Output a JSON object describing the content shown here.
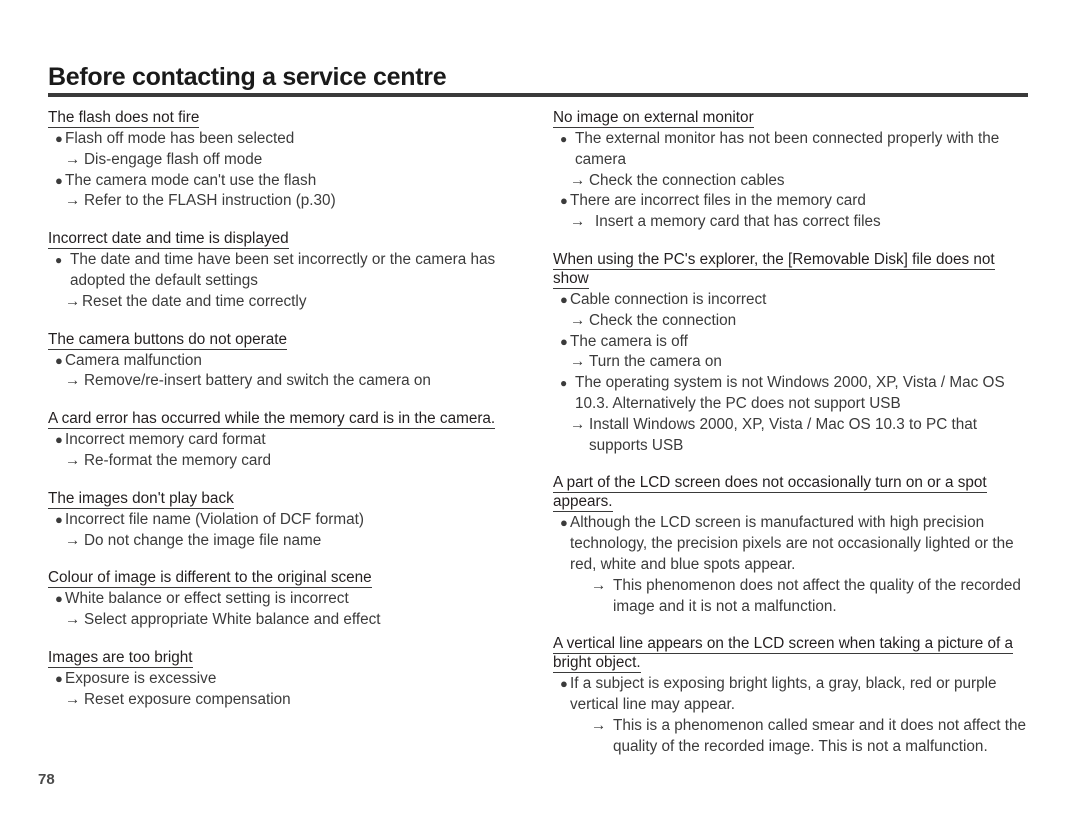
{
  "page": {
    "title": "Before contacting a service centre",
    "folio": "78"
  },
  "left_column": [
    {
      "heading": "The flash does not fire",
      "lines": [
        {
          "type": "bullet",
          "gap": false,
          "text": "Flash off mode has been selected"
        },
        {
          "type": "arrow",
          "indent": "tight",
          "text": "Dis-engage flash off mode"
        },
        {
          "type": "bullet",
          "gap": false,
          "text": "The camera mode can't use the flash"
        },
        {
          "type": "arrow",
          "indent": "tight",
          "text": "Refer to the FLASH instruction (p.30)"
        }
      ]
    },
    {
      "heading": "Incorrect date and time is displayed",
      "lines": [
        {
          "type": "bullet",
          "gap": true,
          "text": "The date and time have been set incorrectly or the camera has adopted the default settings"
        },
        {
          "type": "arrow",
          "indent": "none",
          "text": "Reset the date and time correctly"
        }
      ]
    },
    {
      "heading": "The camera buttons do not operate",
      "lines": [
        {
          "type": "bullet",
          "gap": false,
          "text": "Camera malfunction"
        },
        {
          "type": "arrow",
          "indent": "tight",
          "text": "Remove/re-insert battery and switch the camera on"
        }
      ]
    },
    {
      "heading": "A card error has occurred while the memory card is in the camera.",
      "lines": [
        {
          "type": "bullet",
          "gap": false,
          "text": "Incorrect memory card format"
        },
        {
          "type": "arrow",
          "indent": "tight",
          "text": "Re-format the memory card"
        }
      ]
    },
    {
      "heading": "The images don't play back",
      "lines": [
        {
          "type": "bullet",
          "gap": false,
          "text": "Incorrect file name (Violation of DCF format)"
        },
        {
          "type": "arrow",
          "indent": "tight",
          "text": "Do not change the image file name"
        }
      ]
    },
    {
      "heading": "Colour of image is different to the original scene",
      "lines": [
        {
          "type": "bullet",
          "gap": false,
          "text": "White balance or effect setting is incorrect"
        },
        {
          "type": "arrow",
          "indent": "tight",
          "text": "Select appropriate White balance and effect"
        }
      ]
    },
    {
      "heading": "Images are too bright",
      "lines": [
        {
          "type": "bullet",
          "gap": false,
          "text": "Exposure is excessive"
        },
        {
          "type": "arrow",
          "indent": "tight",
          "text": "Reset exposure compensation"
        }
      ]
    }
  ],
  "right_column": [
    {
      "heading": "No image on external monitor",
      "lines": [
        {
          "type": "bullet",
          "gap": true,
          "text": "The external monitor has not been connected properly with the camera"
        },
        {
          "type": "arrow",
          "indent": "tight",
          "text": "Check the connection cables"
        },
        {
          "type": "bullet",
          "gap": false,
          "text": "There are incorrect files in the memory card"
        },
        {
          "type": "arrow",
          "indent": "wide",
          "text": "Insert a memory card that has correct files"
        }
      ]
    },
    {
      "heading": "When using the PC's explorer, the [Removable Disk] file does not show",
      "lines": [
        {
          "type": "bullet",
          "gap": false,
          "text": "Cable connection is incorrect"
        },
        {
          "type": "arrow",
          "indent": "tight",
          "text": "Check the connection"
        },
        {
          "type": "bullet",
          "gap": false,
          "text": "The camera is off"
        },
        {
          "type": "arrow",
          "indent": "tight",
          "text": "Turn the camera on"
        },
        {
          "type": "bullet",
          "gap": true,
          "text": "The operating system is not Windows 2000, XP, Vista / Mac OS 10.3. Alternatively the PC does not support USB"
        },
        {
          "type": "arrow",
          "indent": "tight",
          "text": "Install Windows 2000, XP, Vista / Mac OS 10.3 to PC that supports USB"
        }
      ]
    },
    {
      "heading": "A part of the LCD screen does not occasionally turn on or a spot appears.",
      "lines": [
        {
          "type": "bullet",
          "gap": false,
          "text": "Although the LCD screen is manufactured with high precision technology, the precision pixels are not occasionally lighted or the red, white and blue spots appear."
        },
        {
          "type": "arrow",
          "indent": "deep",
          "text": "This phenomenon does not affect the quality of the recorded image and it is not a malfunction."
        }
      ]
    },
    {
      "heading": "A vertical line appears on the LCD screen when taking a picture of a bright object.",
      "lines": [
        {
          "type": "bullet",
          "gap": false,
          "text": "If a subject is exposing bright lights, a gray, black, red or purple vertical line may appear."
        },
        {
          "type": "arrow",
          "indent": "deep",
          "text": "This is a phenomenon called smear and it does not affect the quality of the recorded image. This is not a malfunction."
        }
      ]
    }
  ],
  "glyphs": {
    "bullet": "●",
    "arrow": "→"
  }
}
